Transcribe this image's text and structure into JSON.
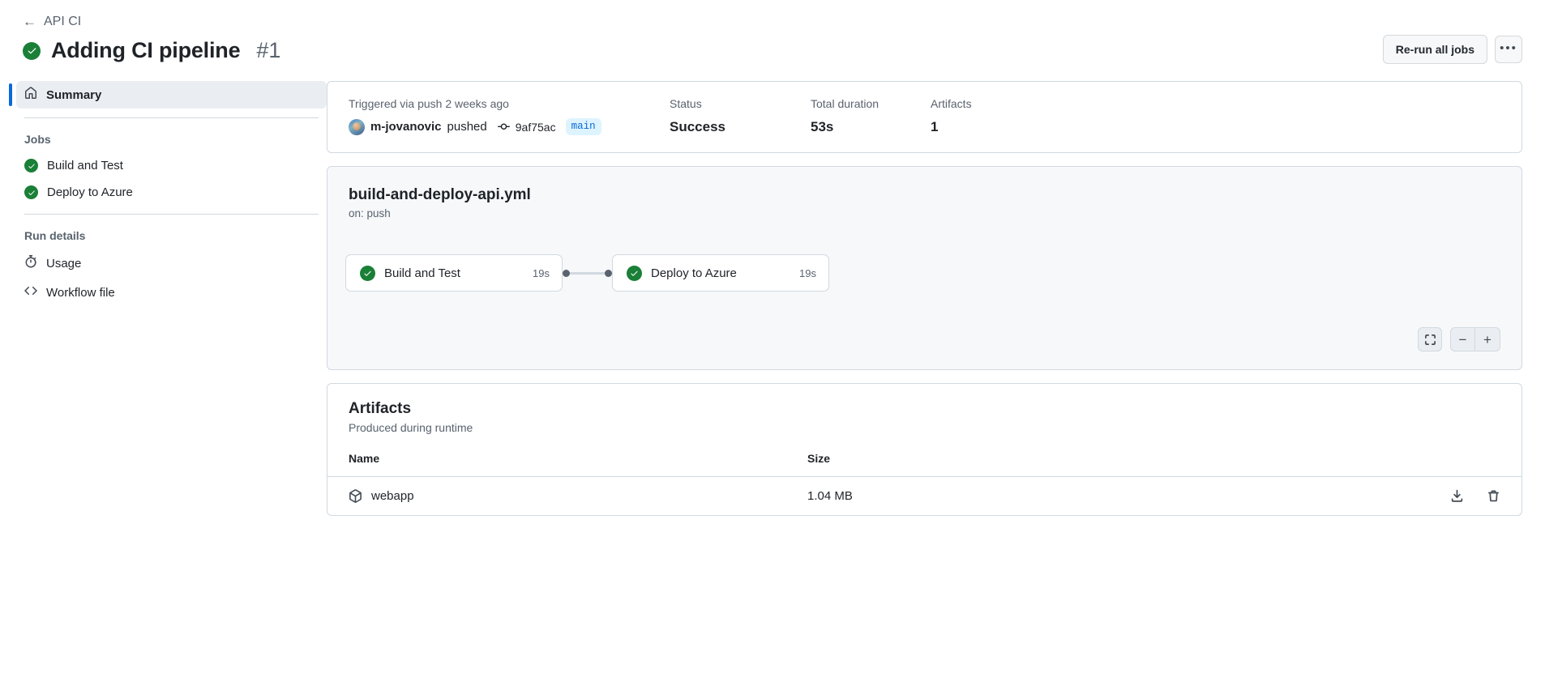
{
  "header": {
    "breadcrumb_back_icon": "arrow-left-icon",
    "breadcrumb_label": "API CI",
    "status_icon": "check-circle-icon",
    "run_title": "Adding CI pipeline",
    "run_number": "#1",
    "rerun_label": "Re-run all jobs",
    "more_label": "•••"
  },
  "sidebar": {
    "summary": {
      "label": "Summary",
      "icon": "home-icon"
    },
    "jobs_heading": "Jobs",
    "jobs": [
      {
        "label": "Build and Test",
        "icon": "check-circle-icon"
      },
      {
        "label": "Deploy to Azure",
        "icon": "check-circle-icon"
      }
    ],
    "run_details_heading": "Run details",
    "details": [
      {
        "label": "Usage",
        "icon": "stopwatch-icon"
      },
      {
        "label": "Workflow file",
        "icon": "code-file-icon"
      }
    ]
  },
  "info": {
    "trigger_label": "Triggered via push 2 weeks ago",
    "actor": "m-jovanovic",
    "action_word": "pushed",
    "commit_icon": "git-commit-icon",
    "commit_sha": "9af75ac",
    "branch": "main",
    "status_label": "Status",
    "status_value": "Success",
    "duration_label": "Total duration",
    "duration_value": "53s",
    "artifacts_label": "Artifacts",
    "artifacts_value": "1"
  },
  "graph": {
    "workflow_file": "build-and-deploy-api.yml",
    "trigger": "on: push",
    "nodes": [
      {
        "label": "Build and Test",
        "duration": "19s",
        "icon": "check-circle-icon"
      },
      {
        "label": "Deploy to Azure",
        "duration": "19s",
        "icon": "check-circle-icon"
      }
    ],
    "controls": {
      "fit_icon": "fullscreen-icon",
      "zoom_out": "−",
      "zoom_in": "+"
    }
  },
  "artifacts": {
    "title": "Artifacts",
    "subtitle": "Produced during runtime",
    "col_name": "Name",
    "col_size": "Size",
    "rows": [
      {
        "name": "webapp",
        "size": "1.04 MB",
        "icon": "package-icon",
        "download_icon": "download-icon",
        "delete_icon": "trash-icon"
      }
    ]
  },
  "colors": {
    "success_green": "#1a7f37",
    "accent_blue": "#0969da",
    "branch_badge_bg": "#ddf4ff",
    "border": "#d1d9e0",
    "canvas": "#f6f8fa",
    "muted_text": "#59636e"
  }
}
